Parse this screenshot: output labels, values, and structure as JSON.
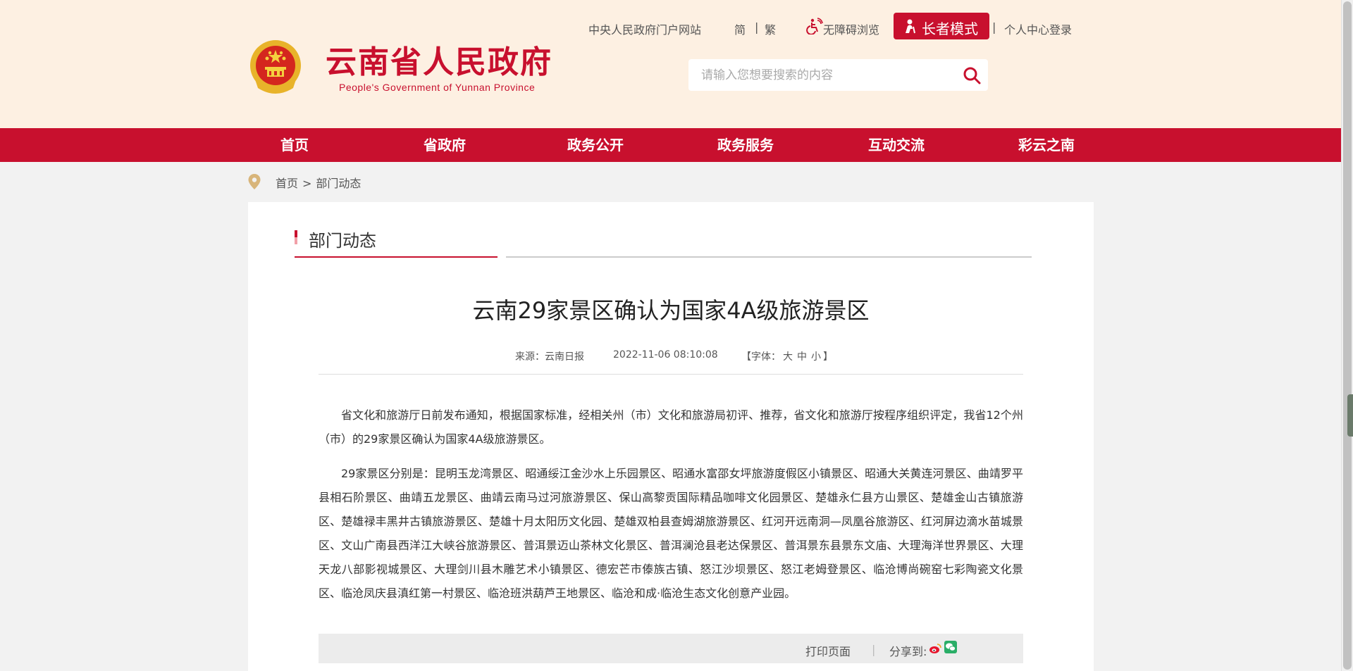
{
  "header": {
    "site_title": "云南省人民政府",
    "site_subtitle": "People's Government of Yunnan Province",
    "links": {
      "central_portal": "中央人民政府门户网站",
      "simplified": "简",
      "separator": "|",
      "traditional": "繁",
      "accessibility": "无障碍浏览",
      "elder_mode": "长者模式",
      "login": "个人中心登录"
    },
    "search": {
      "placeholder": "请输入您想要搜索的内容"
    }
  },
  "nav": [
    "首页",
    "省政府",
    "政务公开",
    "政务服务",
    "互动交流",
    "彩云之南"
  ],
  "breadcrumb": {
    "home": "首页",
    "sep": ">",
    "current": "部门动态"
  },
  "section": {
    "title": "部门动态"
  },
  "article": {
    "title": "云南29家景区确认为国家4A级旅游景区",
    "source": "来源：云南日报",
    "date": "2022-11-06 08:10:08",
    "font_prefix": "【字体：",
    "font_large": "大",
    "font_medium": "中",
    "font_small": "小",
    "font_suffix": "】",
    "paragraphs": [
      "省文化和旅游厅日前发布通知，根据国家标准，经相关州（市）文化和旅游局初评、推荐，省文化和旅游厅按程序组织评定，我省12个州（市）的29家景区确认为国家4A级旅游景区。",
      "29家景区分别是：昆明玉龙湾景区、昭通绥江金沙水上乐园景区、昭通水富邵女坪旅游度假区小镇景区、昭通大关黄连河景区、曲靖罗平县相石阶景区、曲靖五龙景区、曲靖云南马过河旅游景区、保山高黎贡国际精品咖啡文化园景区、楚雄永仁县方山景区、楚雄金山古镇旅游区、楚雄禄丰黑井古镇旅游景区、楚雄十月太阳历文化园、楚雄双柏县查姆湖旅游景区、红河开远南洞—凤凰谷旅游区、红河屏边滴水苗城景区、文山广南县西洋江大峡谷旅游景区、普洱景迈山茶林文化景区、普洱澜沧县老达保景区、普洱景东县景东文庙、大理海洋世界景区、大理天龙八部影视城景区、大理剑川县木雕艺术小镇景区、德宏芒市傣族古镇、怒江沙坝景区、怒江老姆登景区、临沧博尚碗窑七彩陶瓷文化景区、临沧凤庆县滇红第一村景区、临沧班洪葫芦王地景区、临沧和成·临沧生态文化创意产业园。"
    ]
  },
  "share": {
    "print": "打印页面",
    "sep": "|",
    "label": "分享到:"
  },
  "colors": {
    "brand_red": "#c8102e",
    "header_bg": "#fdf0e2",
    "page_bg": "#f2f2f2"
  }
}
